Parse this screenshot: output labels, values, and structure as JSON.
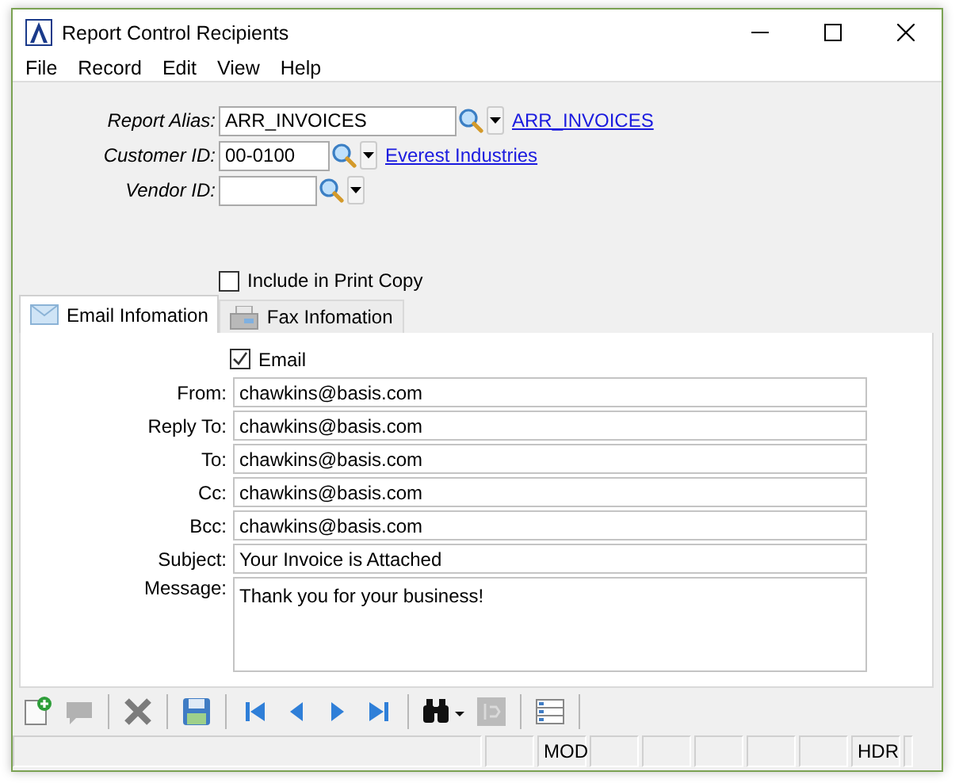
{
  "window": {
    "title": "Report Control Recipients"
  },
  "menu": [
    "File",
    "Record",
    "Edit",
    "View",
    "Help"
  ],
  "header_fields": [
    {
      "label": "Report Alias:",
      "value": "ARR_INVOICES",
      "link": "ARR_INVOICES"
    },
    {
      "label": "Customer ID:",
      "value": "00-0100",
      "link": "Everest Industries"
    },
    {
      "label": "Vendor ID:"
    }
  ],
  "include_print_copy": {
    "label": "Include in Print Copy",
    "checked": false
  },
  "tabs": [
    {
      "label": "Email Infomation",
      "kind": "email",
      "selected": true
    },
    {
      "label": "Fax Infomation",
      "kind": "fax",
      "selected": false
    }
  ],
  "email_checkbox": {
    "label": "Email",
    "checked": true
  },
  "email_fields": [
    {
      "label": "From:",
      "value": "chawkins@basis.com"
    },
    {
      "label": "Reply To:",
      "value": "chawkins@basis.com"
    },
    {
      "label": "To:",
      "value": "chawkins@basis.com"
    },
    {
      "label": "Cc:",
      "value": "chawkins@basis.com"
    },
    {
      "label": "Bcc:",
      "value": "chawkins@basis.com"
    },
    {
      "label": "Subject:",
      "value": "Your Invoice is Attached"
    }
  ],
  "message": {
    "label": "Message:",
    "value": "Thank you for your business!"
  },
  "toolbar": [
    {
      "kind": "new",
      "disabled": false
    },
    {
      "kind": "edit",
      "disabled": true
    },
    {
      "kind": "sep"
    },
    {
      "kind": "delete",
      "disabled": false
    },
    {
      "kind": "sep"
    },
    {
      "kind": "save",
      "disabled": false
    },
    {
      "kind": "sep"
    },
    {
      "kind": "first",
      "disabled": false
    },
    {
      "kind": "prev",
      "disabled": false
    },
    {
      "kind": "next",
      "disabled": false
    },
    {
      "kind": "last",
      "disabled": false
    },
    {
      "kind": "sep"
    },
    {
      "kind": "find",
      "disabled": false
    },
    {
      "kind": "jump",
      "disabled": true
    },
    {
      "kind": "sep"
    },
    {
      "kind": "list",
      "disabled": false
    },
    {
      "kind": "sep"
    }
  ],
  "status_bar": [
    {
      "kind": "main"
    },
    {
      "kind": "blank"
    },
    {
      "kind": "text",
      "text": "MOD"
    },
    {
      "kind": "blank"
    },
    {
      "kind": "blank"
    },
    {
      "kind": "blank"
    },
    {
      "kind": "blank"
    },
    {
      "kind": "blank"
    },
    {
      "kind": "text",
      "text": "HDR"
    },
    {
      "kind": "end"
    }
  ]
}
